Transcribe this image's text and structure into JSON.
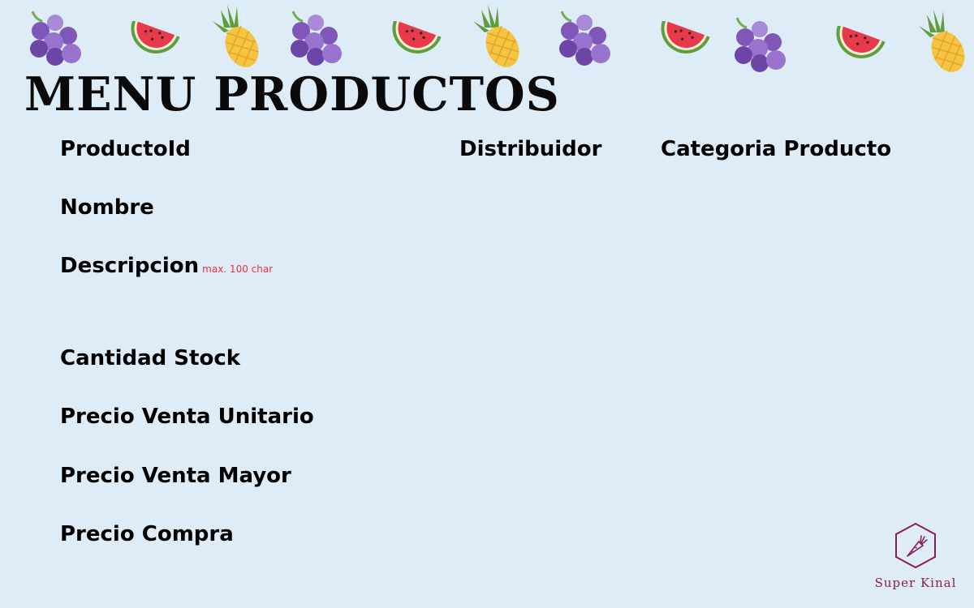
{
  "page": {
    "title": "MENU PRODUCTOS"
  },
  "decoration": {
    "fruits": [
      "grapes-icon",
      "watermelon-icon",
      "pineapple-icon",
      "grapes-icon",
      "watermelon-icon",
      "pineapple-icon",
      "grapes-icon",
      "watermelon-icon",
      "grapes-icon",
      "watermelon-icon",
      "pineapple-icon"
    ]
  },
  "fields": {
    "producto_id": "ProductoId",
    "nombre": "Nombre",
    "descripcion": "Descripcion",
    "descripcion_hint": "max. 100 char",
    "cantidad_stock": "Cantidad Stock",
    "precio_venta_unitario": "Precio Venta Unitario",
    "precio_venta_mayor": "Precio Venta Mayor",
    "precio_compra": "Precio Compra",
    "distribuidor": "Distribuidor",
    "categoria_producto": "Categoria Producto"
  },
  "brand": {
    "name": "Super Kinal",
    "icon": "carrot-hexagon-logo",
    "color": "#8a1d56"
  },
  "colors": {
    "background": "#deecf7",
    "hint": "#e8333a",
    "grape": "#7e57b8",
    "watermelon": "#e83a4a",
    "pineapple": "#f5c542"
  }
}
